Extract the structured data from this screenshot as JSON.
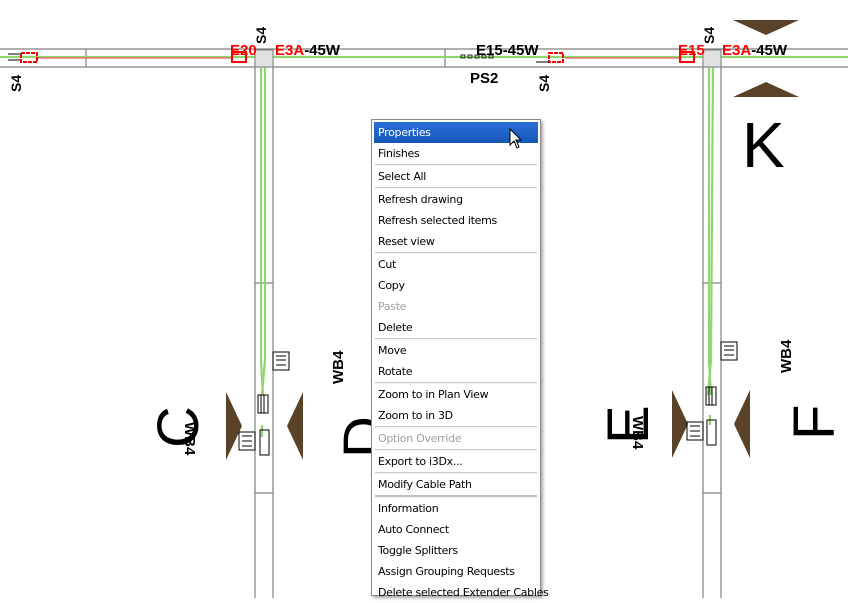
{
  "drawing": {
    "wall_labels": [
      "S4",
      "S4",
      "S4",
      "S4",
      "S4",
      "S4"
    ],
    "fixture_labels": {
      "left_joint_red": "E20",
      "left_joint_red2": "E3A",
      "left_joint_suffix": "-45W",
      "center_label": "E15-45W",
      "center_sub": "PS2",
      "right_joint_red": "E15",
      "right_joint_red2": "E3A",
      "right_joint_suffix": "-45W"
    },
    "wb_labels": [
      "WB4",
      "WB4",
      "WB4",
      "WB4"
    ],
    "grid_letters": {
      "c": "C",
      "d": "D",
      "e": "E",
      "f": "F",
      "k": "K"
    },
    "colors": {
      "cable_green": "#8fd66f",
      "fixture_red": "#ff0000",
      "marker_brown": "#5a4228",
      "wall_gray": "#808080",
      "joint_fill": "#e0e0e0"
    }
  },
  "context_menu": {
    "groups": [
      [
        {
          "label": "Properties",
          "state": "highlighted"
        },
        {
          "label": "Finishes",
          "state": "enabled"
        }
      ],
      [
        {
          "label": "Select All",
          "state": "enabled"
        }
      ],
      [
        {
          "label": "Refresh drawing",
          "state": "enabled"
        },
        {
          "label": "Refresh selected items",
          "state": "enabled"
        },
        {
          "label": "Reset view",
          "state": "enabled"
        }
      ],
      [
        {
          "label": "Cut",
          "state": "enabled"
        },
        {
          "label": "Copy",
          "state": "enabled"
        },
        {
          "label": "Paste",
          "state": "disabled"
        },
        {
          "label": "Delete",
          "state": "enabled"
        }
      ],
      [
        {
          "label": "Move",
          "state": "enabled"
        },
        {
          "label": "Rotate",
          "state": "enabled"
        }
      ],
      [
        {
          "label": "Zoom to in Plan View",
          "state": "enabled"
        },
        {
          "label": "Zoom to in 3D",
          "state": "enabled"
        }
      ],
      [
        {
          "label": "Option Override",
          "state": "disabled"
        }
      ],
      [
        {
          "label": "Export to i3Dx...",
          "state": "enabled"
        }
      ],
      [
        {
          "label": "Modify Cable Path",
          "state": "enabled"
        }
      ],
      [
        {
          "label": "Information",
          "state": "enabled"
        },
        {
          "label": "Auto Connect",
          "state": "enabled"
        },
        {
          "label": "Toggle Splitters",
          "state": "enabled"
        },
        {
          "label": "Assign Grouping Requests",
          "state": "enabled"
        },
        {
          "label": "Delete selected Extender Cables",
          "state": "enabled"
        }
      ]
    ]
  },
  "cursor": {
    "icon": "arrow-pointer-icon"
  }
}
